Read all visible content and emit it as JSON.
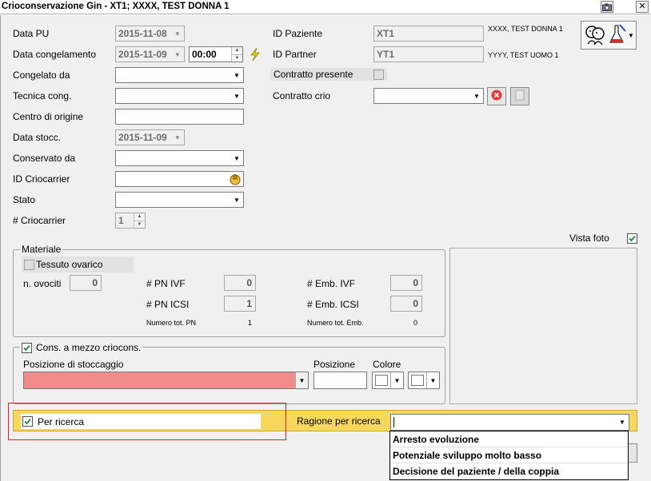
{
  "window": {
    "title": "Crioconservazione Gin  - XT1; XXXX, TEST DONNA 1",
    "camera_icon": "camera-icon",
    "close_label": "✕"
  },
  "left": {
    "data_pu_label": "Data PU",
    "data_pu_value": "2015-11-08",
    "data_cong_label": "Data congelamento",
    "data_cong_value": "2015-11-09",
    "time_value": "00:00",
    "congelato_da_label": "Congelato da",
    "tecnica_label": "Tecnica cong.",
    "centro_label": "Centro di origine",
    "data_stocc_label": "Data stocc.",
    "data_stocc_value": "2015-11-09",
    "conservato_label": "Conservato da",
    "id_criocarrier_label": "ID Criocarrier",
    "stato_label": "Stato",
    "num_criocarrier_label": "# Criocarrier",
    "num_criocarrier_value": "1"
  },
  "right": {
    "id_paziente_label": "ID Paziente",
    "id_paziente_value": "XT1",
    "paziente_name": "XXXX, TEST DONNA 1",
    "id_partner_label": "ID Partner",
    "id_partner_value": "YT1",
    "partner_name": "YYYY, TEST UOMO 1",
    "contratto_presente_label": "Contratto presente",
    "contratto_crio_label": "Contratto crio",
    "vista_foto_label": "Vista foto"
  },
  "materiale": {
    "title": "Materiale",
    "tessuto_label": "Tessuto ovarico",
    "ovociti_label": "n. ovociti",
    "ovociti_value": "0",
    "pn_ivf_label": "# PN IVF",
    "pn_ivf_value": "0",
    "pn_icsi_label": "# PN ICSI",
    "pn_icsi_value": "1",
    "tot_pn_label": "Numero tot. PN",
    "tot_pn_value": "1",
    "emb_ivf_label": "# Emb. IVF",
    "emb_ivf_value": "0",
    "emb_icsi_label": "# Emb. ICSI",
    "emb_icsi_value": "0",
    "tot_emb_label": "Numero tot. Emb.",
    "tot_emb_value": "0"
  },
  "cons": {
    "title": "Cons. a mezzo criocons.",
    "posizione_stocc_label": "Posizione di stoccaggio",
    "posizione_label": "Posizione",
    "colore_label": "Colore"
  },
  "ricerca": {
    "per_ricerca_label": "Per ricerca",
    "ragione_label": "Ragione per ricerca",
    "options": [
      "Arresto evoluzione",
      "Potenziale sviluppo molto basso",
      "Decisione del paziente / della coppia"
    ]
  },
  "colors": {
    "highlight_bar": "#f7d75c",
    "position_field": "#f08c8c",
    "annotation_red": "#e02020"
  }
}
